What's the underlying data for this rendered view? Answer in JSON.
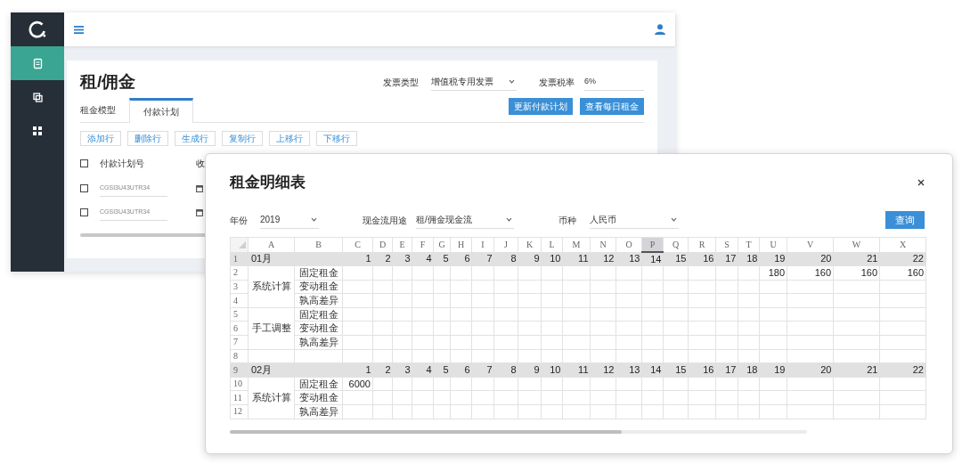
{
  "app": {
    "sidebar": {
      "items": [
        {
          "kind": "clipboard",
          "selected": true
        },
        {
          "kind": "copy",
          "selected": false
        },
        {
          "kind": "grid",
          "selected": false
        }
      ]
    },
    "page": {
      "title": "租/佣金",
      "invoice_type": {
        "label": "发票类型",
        "value": "增值税专用发票"
      },
      "tax_rate": {
        "label": "发票税率",
        "value": "6%"
      },
      "tabs": [
        {
          "label": "租金模型",
          "selected": false
        },
        {
          "label": "付款计划",
          "selected": true
        }
      ],
      "actions": [
        "更新付款计划",
        "查看每日租金"
      ],
      "row_buttons": [
        "添加行",
        "删除行",
        "生成行",
        "复制行",
        "上移行",
        "下移行"
      ],
      "table": {
        "header_checked": false,
        "columns": [
          "付款计划号",
          "收"
        ],
        "rows": [
          {
            "checked": false,
            "plan_no": "CGSI3U43UTR34"
          },
          {
            "checked": false,
            "plan_no": "CGSI3U43UTR34"
          }
        ]
      }
    }
  },
  "dialog": {
    "title": "租金明细表",
    "filters": [
      {
        "label": "年份",
        "value": "2019"
      },
      {
        "label": "现金流用途",
        "value": "租/佣金现金流"
      },
      {
        "label": "币种",
        "value": "人民币"
      }
    ],
    "query_button": "查询",
    "sheet": {
      "columns": [
        {
          "label": "A",
          "selected": false
        },
        {
          "label": "B",
          "selected": false
        },
        {
          "label": "C",
          "selected": false
        },
        {
          "label": "D",
          "selected": false
        },
        {
          "label": "E",
          "selected": false
        },
        {
          "label": "F",
          "selected": false
        },
        {
          "label": "G",
          "selected": false
        },
        {
          "label": "H",
          "selected": false
        },
        {
          "label": "I",
          "selected": false
        },
        {
          "label": "J",
          "selected": false
        },
        {
          "label": "K",
          "selected": false
        },
        {
          "label": "L",
          "selected": false
        },
        {
          "label": "M",
          "selected": false
        },
        {
          "label": "N",
          "selected": false
        },
        {
          "label": "O",
          "selected": false
        },
        {
          "label": "P",
          "selected": true
        },
        {
          "label": "Q",
          "selected": false
        },
        {
          "label": "R",
          "selected": false
        },
        {
          "label": "S",
          "selected": false
        },
        {
          "label": "T",
          "selected": false
        },
        {
          "label": "U",
          "selected": false
        },
        {
          "label": "V",
          "selected": false
        },
        {
          "label": "W",
          "selected": false
        },
        {
          "label": "X",
          "selected": false
        }
      ],
      "blocks": [
        {
          "kind": "month",
          "row": "1",
          "label": "01月",
          "days": [
            "1",
            "2",
            "3",
            "4",
            "5",
            "6",
            "7",
            "8",
            "9",
            "10",
            "11",
            "12",
            "13",
            "14",
            "15",
            "16",
            "17",
            "18",
            "19",
            "20",
            "21",
            "22"
          ]
        },
        {
          "kind": "group",
          "label": "系统计算",
          "rows": [
            {
              "row": "2",
              "item": "固定租金",
              "values": [
                {
                  "kind": "empty"
                },
                {
                  "kind": "empty"
                },
                {
                  "kind": "empty"
                },
                {
                  "kind": "empty"
                },
                {
                  "kind": "empty"
                },
                {
                  "kind": "empty"
                },
                {
                  "kind": "empty"
                },
                {
                  "kind": "empty"
                },
                {
                  "kind": "empty"
                },
                {
                  "kind": "empty"
                },
                {
                  "kind": "empty"
                },
                {
                  "kind": "empty"
                },
                {
                  "kind": "empty"
                },
                {
                  "kind": "empty"
                },
                {
                  "kind": "empty"
                },
                {
                  "kind": "empty"
                },
                {
                  "kind": "empty"
                },
                {
                  "kind": "empty"
                },
                {
                  "kind": "number",
                  "text": "180"
                },
                {
                  "kind": "number",
                  "text": "160"
                },
                {
                  "kind": "number",
                  "text": "160"
                },
                {
                  "kind": "number",
                  "text": "160"
                }
              ]
            },
            {
              "row": "3",
              "item": "变动租金"
            },
            {
              "row": "4",
              "item": "孰高差异"
            }
          ]
        },
        {
          "kind": "group",
          "label": "手工调整",
          "rows": [
            {
              "row": "5",
              "item": "固定租金"
            },
            {
              "row": "6",
              "item": "变动租金"
            },
            {
              "row": "7",
              "item": "孰高差异"
            }
          ]
        },
        {
          "kind": "blank",
          "row": "8"
        },
        {
          "kind": "month",
          "row": "9",
          "label": "02月",
          "days": [
            "1",
            "2",
            "3",
            "4",
            "5",
            "6",
            "7",
            "8",
            "9",
            "10",
            "11",
            "12",
            "13",
            "14",
            "15",
            "16",
            "17",
            "18",
            "19",
            "20",
            "21",
            "22"
          ]
        },
        {
          "kind": "group",
          "label": "系统计算",
          "rows": [
            {
              "row": "10",
              "item": "固定租金",
              "values": [
                {
                  "kind": "number",
                  "text": "6000"
                }
              ]
            },
            {
              "row": "11",
              "item": "变动租金"
            },
            {
              "row": "12",
              "item": "孰高差异"
            }
          ]
        }
      ]
    }
  }
}
